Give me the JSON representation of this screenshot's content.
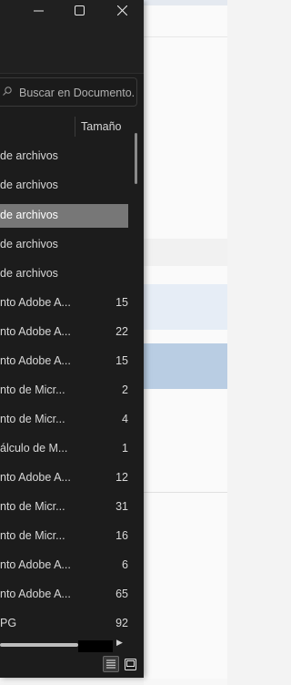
{
  "window": {
    "controls": {
      "minimize": "minimize-icon",
      "maximize": "maximize-icon",
      "close": "close-icon"
    }
  },
  "search": {
    "placeholder": "Buscar en Documento..."
  },
  "columns": {
    "size_label": "Tamaño"
  },
  "rows": [
    {
      "name": "de archivos",
      "size": ""
    },
    {
      "name": "de archivos",
      "size": ""
    },
    {
      "name": "de archivos",
      "size": "",
      "selected": true
    },
    {
      "name": "de archivos",
      "size": ""
    },
    {
      "name": "de archivos",
      "size": ""
    },
    {
      "name": "nto Adobe A...",
      "size": "15"
    },
    {
      "name": "nto Adobe A...",
      "size": "22"
    },
    {
      "name": "nto Adobe A...",
      "size": "15"
    },
    {
      "name": "nto de Micr...",
      "size": "2"
    },
    {
      "name": "nto de Micr...",
      "size": "4"
    },
    {
      "name": "álculo de M...",
      "size": "1"
    },
    {
      "name": "nto Adobe A...",
      "size": "12"
    },
    {
      "name": "nto de Micr...",
      "size": "31"
    },
    {
      "name": "nto de Micr...",
      "size": "16"
    },
    {
      "name": "nto Adobe A...",
      "size": "6"
    },
    {
      "name": "nto Adobe A...",
      "size": "65"
    },
    {
      "name": "PG",
      "size": "92"
    }
  ],
  "view_buttons": {
    "details": "details-view-icon",
    "tiles": "tiles-view-icon"
  },
  "colors": {
    "window_bg": "#1c1c1c",
    "selected_row": "#777777",
    "text": "#d8d8d8",
    "bg_highlight": "#b9cde3"
  }
}
